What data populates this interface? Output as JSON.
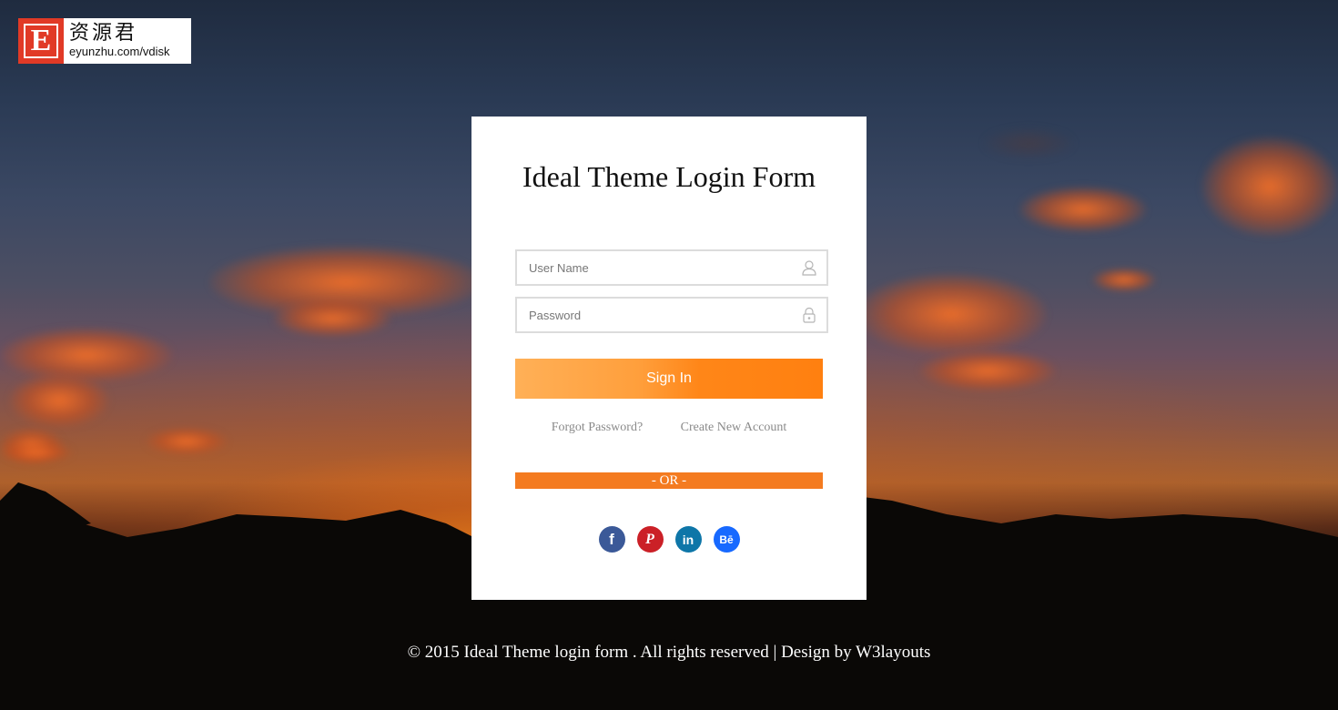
{
  "logo": {
    "letter": "E",
    "name_cn": "资源君",
    "url": "eyunzhu.com/vdisk"
  },
  "form": {
    "title": "Ideal Theme Login Form",
    "username_placeholder": "User Name",
    "password_placeholder": "Password",
    "username_value": "",
    "password_value": "",
    "signin_label": "Sign In",
    "forgot_label": "Forgot Password?",
    "create_label": "Create New Account",
    "or_label": "- OR -"
  },
  "social": [
    {
      "name": "facebook",
      "glyph": "f",
      "color": "#3b5998"
    },
    {
      "name": "pinterest",
      "glyph": "P",
      "color": "#cb2027"
    },
    {
      "name": "linkedin",
      "glyph": "in",
      "color": "#0e76a8"
    },
    {
      "name": "behance",
      "glyph": "Bē",
      "color": "#1769ff"
    }
  ],
  "colors": {
    "accent_orange": "#f47b20",
    "signin_orange": "#ff8618",
    "card_bg": "#ffffff",
    "logo_red": "#e13a26"
  },
  "icons": {
    "username": "user-icon",
    "password": "lock-icon"
  },
  "footer": {
    "text": "© 2015 Ideal Theme login form . All rights reserved | Design by W3layouts"
  }
}
